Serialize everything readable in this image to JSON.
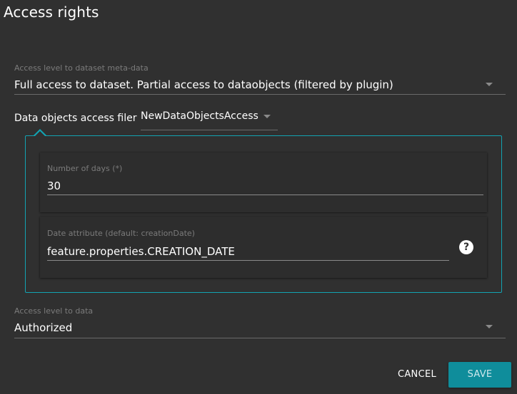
{
  "dialog": {
    "title": "Access rights",
    "metadata_access": {
      "label": "Access level to dataset meta-data",
      "value": "Full access to dataset. Partial access to dataobjects (filtered by plugin)"
    },
    "filter": {
      "label": "Data objects access filer",
      "value": "NewDataObjectsAccess"
    },
    "plugin_config": {
      "days": {
        "label": "Number of days (*)",
        "value": "30"
      },
      "date_attribute": {
        "label": "Date attribute (default: creationDate)",
        "value": "feature.properties.CREATION_DATE",
        "help_icon": "help-circle-icon"
      }
    },
    "data_access": {
      "label": "Access level to data",
      "value": "Authorized"
    },
    "actions": {
      "cancel_label": "CANCEL",
      "save_label": "SAVE"
    }
  },
  "colors": {
    "background": "#303030",
    "accent": "#12a3b2",
    "save_button": "#0f8d9b",
    "muted_label": "#7b7b7b"
  }
}
